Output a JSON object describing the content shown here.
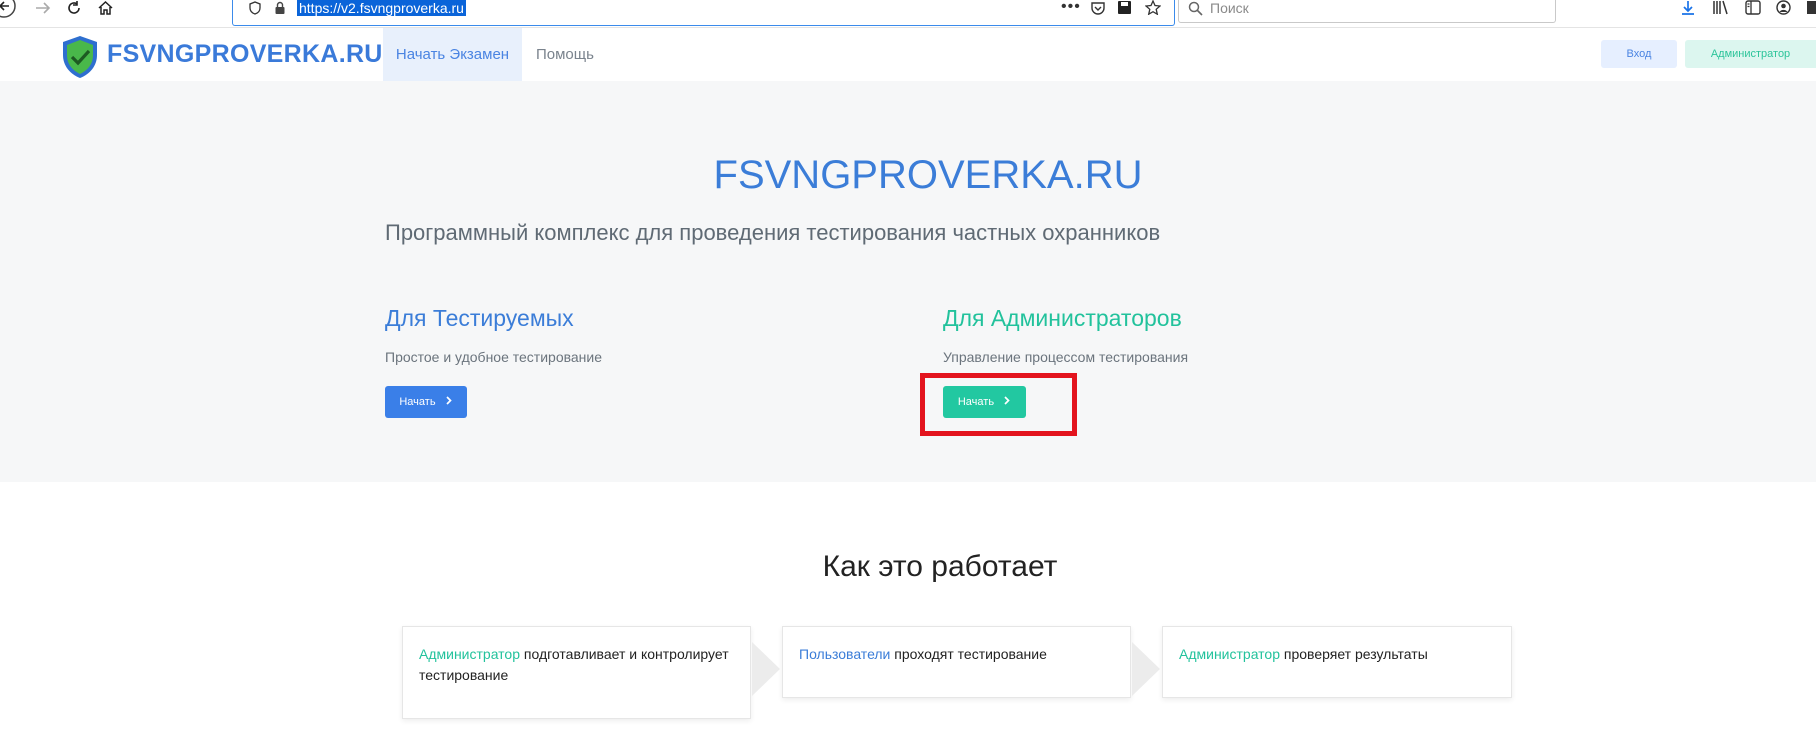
{
  "browser": {
    "url": "https://v2.fsvngproverka.ru",
    "search_placeholder": "Поиск",
    "icons": [
      "back-icon",
      "forward-icon",
      "reload-icon",
      "home-icon",
      "shield-icon",
      "lock-icon",
      "more-icon",
      "pocket-icon",
      "save-icon",
      "star-icon",
      "search-icon",
      "download-icon",
      "library-icon",
      "sidebar-icon",
      "account-icon"
    ]
  },
  "navbar": {
    "logo": "FSVNGPROVERKA.RU",
    "links": [
      {
        "label": "Начать Экзамен",
        "active": true
      },
      {
        "label": "Помощь",
        "active": false
      }
    ],
    "login_label": "Вход",
    "admin_label": "Администратор"
  },
  "hero": {
    "title": "FSVNGPROVERKA.RU",
    "subtitle": "Программный комплекс для проведения тестирования частных охранников",
    "col1": {
      "title": "Для Тестируемых",
      "description": "Простое и удобное тестирование",
      "button": "Начать"
    },
    "col2": {
      "title": "Для Администраторов",
      "description": "Управление процессом тестирования",
      "button": "Начать"
    }
  },
  "how": {
    "title": "Как это работает",
    "steps": [
      {
        "highlight": "Администратор",
        "text": " подготавливает и контролирует тестирование"
      },
      {
        "highlight": "Пользователи",
        "text": " проходят тестирование"
      },
      {
        "highlight": "Администратор",
        "text": " проверяет результаты"
      }
    ]
  },
  "colors": {
    "primary_blue": "#3a7fe8",
    "accent_green": "#22c8a1",
    "highlight_red": "#e3141e"
  }
}
